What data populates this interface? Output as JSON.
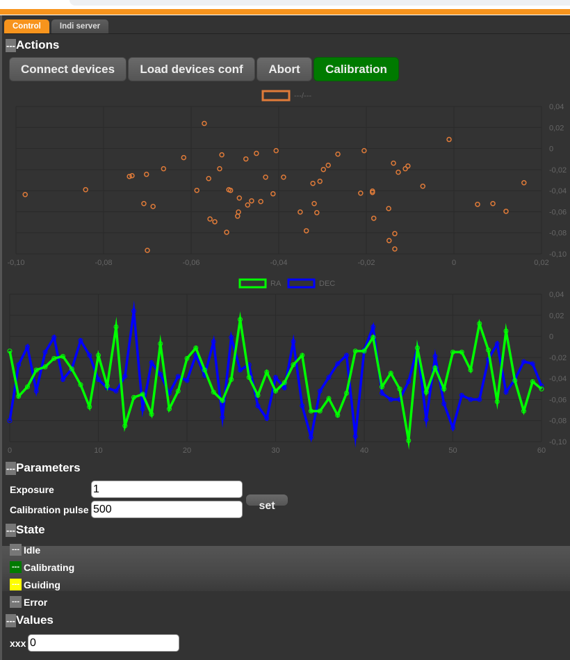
{
  "tabs": [
    {
      "label": "Control",
      "active": true
    },
    {
      "label": "Indi server",
      "active": false
    }
  ],
  "sections": {
    "actions": "Actions",
    "parameters": "Parameters",
    "state": "State",
    "values": "Values"
  },
  "collapse_marker": "---",
  "actions": {
    "buttons": [
      {
        "label": "Connect devices",
        "color": "#5f5f5f"
      },
      {
        "label": "Load devices conf",
        "color": "#5f5f5f"
      },
      {
        "label": "Abort",
        "color": "#5f5f5f"
      },
      {
        "label": "Calibration",
        "color": "#007a00"
      }
    ]
  },
  "parameters": {
    "exposure_label": "Exposure",
    "exposure_value": "1",
    "pulse_label": "Calibration pulse",
    "pulse_value": "500",
    "set_label": "set"
  },
  "state": {
    "items": [
      {
        "label": "Idle",
        "color": "#777777"
      },
      {
        "label": "Calibrating",
        "color": "#007a00"
      },
      {
        "label": "Guiding",
        "color": "#ffff00"
      },
      {
        "label": "Error",
        "color": "#777777"
      }
    ]
  },
  "values": {
    "xxx_label": "xxx",
    "xxx_value": "0"
  },
  "chart_data": [
    {
      "type": "scatter",
      "legend": [
        {
          "name": "---/---",
          "color": "#e07b39"
        }
      ],
      "legend_placement": "top-center",
      "xlim": [
        -0.1,
        0.02
      ],
      "ylim": [
        -0.1,
        0.04
      ],
      "xticks": [
        "-0,10",
        "-0,08",
        "-0,06",
        "-0,04",
        "-0,02",
        "0",
        "0,02"
      ],
      "yticks": [
        "0,04",
        "0,02",
        "0",
        "-0,02",
        "-0,04",
        "-0,06",
        "-0,08",
        "-0,10"
      ],
      "yaxis_side": "right",
      "grid": true,
      "points": [
        [
          -0.0979,
          -0.0437
        ],
        [
          -0.0841,
          -0.0391
        ],
        [
          -0.0741,
          -0.0265
        ],
        [
          -0.0735,
          -0.0258
        ],
        [
          -0.0702,
          -0.0245
        ],
        [
          -0.0708,
          -0.0523
        ],
        [
          -0.0687,
          -0.055
        ],
        [
          -0.07,
          -0.0967
        ],
        [
          -0.0663,
          -0.0192
        ],
        [
          -0.0617,
          -0.0086
        ],
        [
          -0.057,
          0.0238
        ],
        [
          -0.0587,
          -0.0397
        ],
        [
          -0.056,
          -0.0285
        ],
        [
          -0.0557,
          -0.0669
        ],
        [
          -0.0546,
          -0.0695
        ],
        [
          -0.0535,
          -0.0192
        ],
        [
          -0.053,
          -0.006
        ],
        [
          -0.0519,
          -0.0795
        ],
        [
          -0.0514,
          -0.0391
        ],
        [
          -0.051,
          -0.0397
        ],
        [
          -0.0494,
          -0.0642
        ],
        [
          -0.0492,
          -0.0603
        ],
        [
          -0.049,
          -0.047
        ],
        [
          -0.0475,
          -0.0099
        ],
        [
          -0.0471,
          -0.0536
        ],
        [
          -0.0462,
          -0.0497
        ],
        [
          -0.0451,
          -0.0046
        ],
        [
          -0.0441,
          -0.0503
        ],
        [
          -0.043,
          -0.0272
        ],
        [
          -0.0413,
          -0.043
        ],
        [
          -0.0406,
          -0.002
        ],
        [
          -0.0389,
          -0.0272
        ],
        [
          -0.0351,
          -0.0603
        ],
        [
          -0.0337,
          -0.0781
        ],
        [
          -0.0322,
          -0.0331
        ],
        [
          -0.0319,
          -0.0523
        ],
        [
          -0.0313,
          -0.0609
        ],
        [
          -0.0306,
          -0.0311
        ],
        [
          -0.0298,
          -0.0199
        ],
        [
          -0.0287,
          -0.0159
        ],
        [
          -0.0265,
          -0.0053
        ],
        [
          -0.0213,
          -0.0424
        ],
        [
          -0.0205,
          -0.002
        ],
        [
          -0.0186,
          -0.0404
        ],
        [
          -0.0186,
          -0.0417
        ],
        [
          -0.0183,
          -0.0662
        ],
        [
          -0.0149,
          -0.057
        ],
        [
          -0.0148,
          -0.0874
        ],
        [
          -0.0138,
          -0.0139
        ],
        [
          -0.0135,
          -0.0808
        ],
        [
          -0.0135,
          -0.0954
        ],
        [
          -0.0127,
          -0.0225
        ],
        [
          -0.0111,
          -0.0192
        ],
        [
          -0.0105,
          -0.0166
        ],
        [
          -0.0071,
          -0.0358
        ],
        [
          -0.0011,
          0.0086
        ],
        [
          0.0054,
          -0.053
        ],
        [
          0.0089,
          -0.0523
        ],
        [
          0.0119,
          -0.0596
        ],
        [
          0.016,
          -0.0325
        ]
      ]
    },
    {
      "type": "line",
      "legend_placement": "top-center",
      "xlim": [
        0,
        60
      ],
      "ylim": [
        -0.1,
        0.04
      ],
      "xticks": [
        "0",
        "10",
        "20",
        "30",
        "40",
        "50",
        "60"
      ],
      "yticks": [
        "0,04",
        "0,02",
        "0",
        "-0,02",
        "-0,04",
        "-0,06",
        "-0,08",
        "-0,10"
      ],
      "yaxis_side": "right",
      "grid": true,
      "series": [
        {
          "name": "RA",
          "color": "#00ff00",
          "values": [
            -0.014,
            -0.057,
            -0.048,
            -0.032,
            -0.029,
            -0.021,
            -0.019,
            -0.031,
            -0.046,
            -0.067,
            -0.018,
            -0.047,
            0.009,
            -0.085,
            -0.058,
            -0.055,
            -0.074,
            -0.007,
            -0.069,
            -0.052,
            -0.021,
            -0.011,
            -0.032,
            -0.053,
            -0.061,
            -0.041,
            0.016,
            -0.039,
            -0.056,
            -0.034,
            -0.052,
            -0.044,
            -0.027,
            -0.018,
            -0.071,
            -0.071,
            -0.059,
            -0.075,
            -0.054,
            -0.014,
            -0.014,
            -0.001,
            -0.048,
            -0.035,
            -0.05,
            -0.099,
            -0.011,
            -0.053,
            -0.03,
            -0.05,
            -0.015,
            -0.015,
            -0.032,
            0.012,
            -0.013,
            -0.062,
            0.005,
            -0.042,
            -0.071,
            -0.043,
            -0.05
          ]
        },
        {
          "name": "DEC",
          "color": "#0000ff",
          "values": [
            -0.08,
            -0.027,
            -0.01,
            -0.052,
            -0.015,
            -0.001,
            -0.041,
            -0.031,
            -0.004,
            -0.018,
            -0.041,
            -0.049,
            -0.052,
            -0.038,
            0.024,
            -0.069,
            -0.025,
            -0.036,
            -0.054,
            -0.038,
            -0.042,
            -0.018,
            -0.037,
            -0.005,
            -0.077,
            -0.001,
            -0.032,
            -0.027,
            -0.066,
            -0.078,
            -0.039,
            -0.049,
            -0.005,
            -0.066,
            -0.096,
            -0.052,
            -0.039,
            -0.026,
            -0.018,
            -0.095,
            -0.013,
            0.009,
            -0.054,
            -0.06,
            -0.06,
            -0.043,
            -0.011,
            -0.079,
            -0.019,
            -0.064,
            -0.087,
            -0.056,
            -0.06,
            -0.06,
            -0.022,
            -0.007,
            -0.053,
            -0.041,
            -0.024,
            -0.026,
            -0.047
          ]
        }
      ]
    }
  ]
}
